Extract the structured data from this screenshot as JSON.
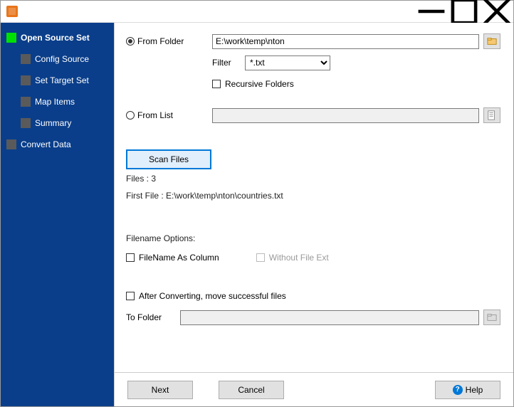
{
  "sidebar": {
    "items": [
      {
        "label": "Open Source Set",
        "active": true,
        "sub": false
      },
      {
        "label": "Config Source",
        "active": false,
        "sub": true
      },
      {
        "label": "Set Target Set",
        "active": false,
        "sub": true
      },
      {
        "label": "Map Items",
        "active": false,
        "sub": true
      },
      {
        "label": "Summary",
        "active": false,
        "sub": true
      },
      {
        "label": "Convert Data",
        "active": false,
        "sub": false
      }
    ]
  },
  "form": {
    "from_folder_label": "From Folder",
    "folder_path": "E:\\work\\temp\\nton",
    "filter_label": "Filter",
    "filter_value": "*.txt",
    "recursive_label": "Recursive Folders",
    "from_list_label": "From List",
    "from_list_value": "",
    "scan_button": "Scan Files",
    "files_count_label": "Files : 3",
    "first_file_label": "First File : E:\\work\\temp\\nton\\countries.txt",
    "filename_options_label": "Filename Options:",
    "filename_as_column_label": "FileName As Column",
    "without_ext_label": "Without File Ext",
    "after_convert_label": "After Converting, move successful files",
    "to_folder_label": "To Folder",
    "to_folder_value": ""
  },
  "footer": {
    "next": "Next",
    "cancel": "Cancel",
    "help": "Help"
  }
}
